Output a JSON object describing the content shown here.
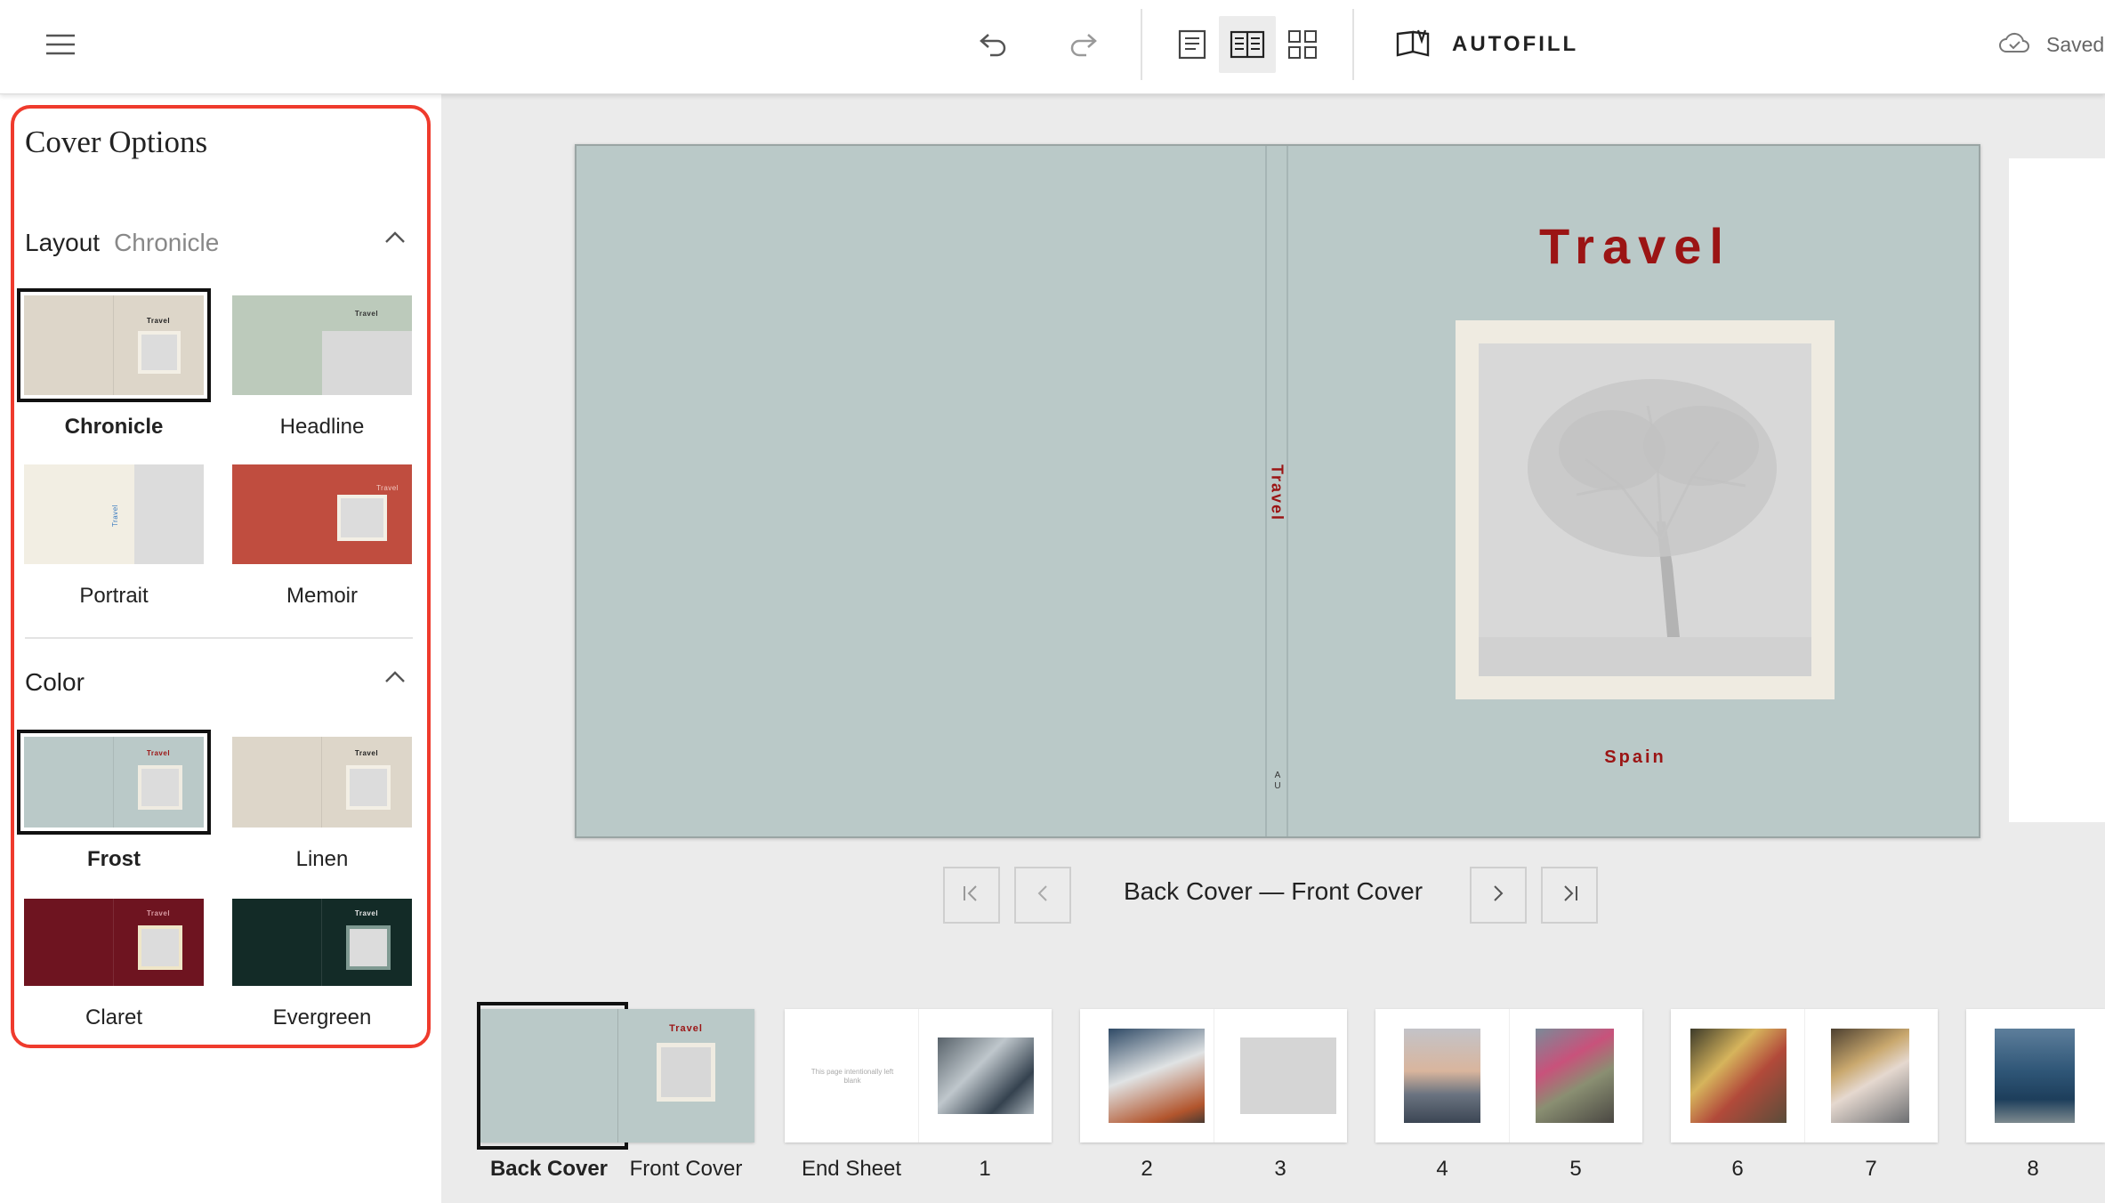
{
  "toolbar": {
    "autofill_label": "AUTOFILL",
    "saved_label": "Saved",
    "icons": [
      "hamburger-menu-icon",
      "undo-icon",
      "redo-icon",
      "single-page-view-icon",
      "spread-view-icon",
      "grid-view-icon",
      "book-icon",
      "cloud-icon"
    ]
  },
  "panel": {
    "title": "Cover Options",
    "layout": {
      "label": "Layout",
      "value": "Chronicle",
      "options": [
        {
          "name": "Chronicle",
          "selected": true
        },
        {
          "name": "Headline",
          "selected": false
        },
        {
          "name": "Portrait",
          "selected": false
        },
        {
          "name": "Memoir",
          "selected": false
        }
      ]
    },
    "color": {
      "label": "Color",
      "options": [
        {
          "name": "Frost",
          "selected": true,
          "hex": "#bac9c8"
        },
        {
          "name": "Linen",
          "selected": false,
          "hex": "#ddd6c9"
        },
        {
          "name": "Claret",
          "selected": false,
          "hex": "#6e1420"
        },
        {
          "name": "Evergreen",
          "selected": false,
          "hex": "#132b27"
        }
      ]
    },
    "thumb_title": "Travel"
  },
  "cover": {
    "title": "Travel",
    "subtitle": "Spain",
    "spine_title": "Travel",
    "spine_mark": "A U",
    "color": "#bac9c8",
    "accent": "#9b1414"
  },
  "navigation": {
    "page_range": "Back Cover — Front Cover"
  },
  "pages": {
    "labels": {
      "back_cover": "Back Cover",
      "front_cover": "Front Cover",
      "end_sheet": "End Sheet",
      "p1": "1",
      "p2": "2",
      "p3": "3",
      "p4": "4",
      "p5": "5",
      "p6": "6",
      "p7": "7",
      "p8": "8"
    },
    "end_sheet_text": "This page intentionally left blank"
  },
  "colors": {
    "highlight": "#ef3b2d",
    "selection": "#111111"
  }
}
